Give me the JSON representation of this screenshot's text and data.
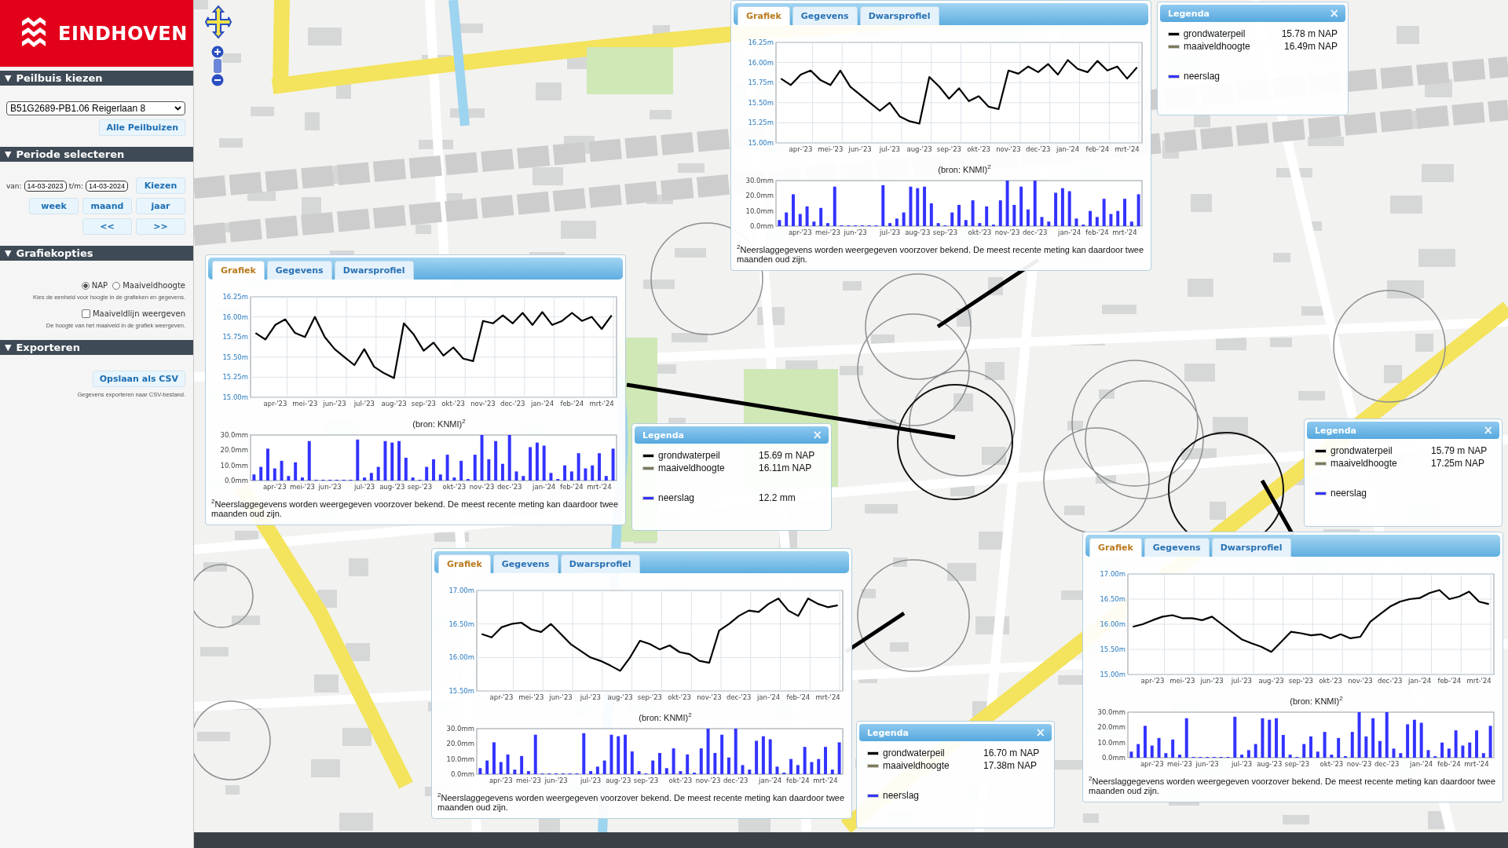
{
  "sidebar": {
    "logo": {
      "text": "EINDHOVEN"
    },
    "sections": [
      {
        "toggle": "▼",
        "title": "Peilbuis kiezen",
        "controls": [
          {
            "kind": "select",
            "value": "B51G2689-PB1.06 Reigerlaan 8"
          },
          {
            "kind": "button",
            "label": "Alle Peilbuizen"
          }
        ]
      },
      {
        "toggle": "▼",
        "title": "Periode selecteren",
        "controls": [
          {
            "kind": "date_range",
            "from_label": "van:",
            "from": "14-03-2023",
            "to_label": "t/m:",
            "to": "14-03-2024",
            "button": "Kiezen"
          },
          {
            "kind": "button_row",
            "buttons": [
              "week",
              "maand",
              "jaar"
            ]
          },
          {
            "kind": "button_row",
            "buttons": [
              "<<",
              ">>"
            ]
          }
        ]
      },
      {
        "toggle": "▼",
        "title": "Grafiekopties",
        "controls": [
          {
            "kind": "radio_group",
            "options": [
              {
                "label": "NAP",
                "selected": true
              },
              {
                "label": "Maaiveldhoogte",
                "selected": false
              }
            ]
          },
          {
            "kind": "hint",
            "text": "Kies de eenheid voor hoogte in de grafieken en gegevens."
          },
          {
            "kind": "checkbox",
            "label": "Maaiveldlijn weergeven",
            "checked": false
          },
          {
            "kind": "hint",
            "text": "De hoogte van het maaiveld in de grafiek weergeven."
          }
        ]
      },
      {
        "toggle": "▼",
        "title": "Exporteren",
        "controls": [
          {
            "kind": "button",
            "label": "Opslaan als CSV"
          },
          {
            "kind": "hint",
            "text": "Gegevens exporteren naar CSV-bestand."
          }
        ]
      }
    ]
  },
  "chart_panels": [
    {
      "tabs": [
        {
          "label": "Grafiek",
          "selected": true
        },
        {
          "label": "Gegevens",
          "selected": false
        },
        {
          "label": "Dwarsprofiel",
          "selected": false
        }
      ],
      "level_chart": {
        "chart_data": {
          "type": "line",
          "categories": [
            null,
            null,
            "apr-'23",
            null,
            null,
            "mei-'23",
            null,
            null,
            "jun-'23",
            null,
            null,
            "jul-'23",
            null,
            null,
            "aug-'23",
            null,
            null,
            "sep-'23",
            null,
            null,
            "okt-'23",
            null,
            null,
            "nov-'23",
            null,
            null,
            "dec-'23",
            null,
            null,
            "jan-'24",
            null,
            null,
            "feb-'24",
            null,
            null,
            "mrt-'24",
            null
          ],
          "series": [
            {
              "color": "#000000",
              "values": [
                15.8,
                15.72,
                15.85,
                15.9,
                15.78,
                15.72,
                15.9,
                15.7,
                15.6,
                15.5,
                15.4,
                15.5,
                15.33,
                15.27,
                15.24,
                15.82,
                15.7,
                15.55,
                15.68,
                15.52,
                15.58,
                15.45,
                15.42,
                15.9,
                15.86,
                15.95,
                15.88,
                15.98,
                15.85,
                16.03,
                15.92,
                15.88,
                16.02,
                15.9,
                15.95,
                15.8,
                15.94
              ]
            }
          ],
          "grid": true,
          "ylim": [
            15,
            16.25
          ],
          "yticks": [
            {
              "value": 15,
              "label": "15.00m"
            },
            {
              "value": 15.25,
              "label": "15.25m"
            },
            {
              "value": 15.5,
              "label": "15.50m"
            },
            {
              "value": 15.75,
              "label": "15.75m"
            },
            {
              "value": 16,
              "label": "16.00m"
            },
            {
              "value": 16.25,
              "label": "16.25m"
            }
          ]
        }
      },
      "source": "(bron: KNMI)$^{2}$",
      "rain_chart": {
        "chart_data": {
          "type": "bar",
          "categories": [
            null,
            null,
            null,
            "apr-'23",
            null,
            null,
            null,
            "mei-'23",
            null,
            null,
            null,
            "jun-'23",
            null,
            null,
            null,
            null,
            "jul-'23",
            null,
            null,
            null,
            "aug-'23",
            null,
            null,
            null,
            "sep-'23",
            null,
            null,
            null,
            null,
            "okt-'23",
            null,
            null,
            null,
            "nov-'23",
            null,
            null,
            null,
            "dec-'23",
            null,
            null,
            null,
            null,
            "jan-'24",
            null,
            null,
            null,
            "feb-'24",
            null,
            null,
            null,
            "mrt-'24",
            null,
            null
          ],
          "series": [
            {
              "color": "#3333ff",
              "values": [
                4,
                9,
                21,
                8,
                13,
                3,
                12,
                2,
                26,
                0,
                0,
                0,
                0,
                0,
                0,
                27,
                2,
                5,
                9,
                26,
                25,
                26,
                15,
                2,
                0,
                9,
                14,
                4,
                17,
                2,
                13,
                1,
                17,
                30,
                14,
                26,
                11,
                30,
                6,
                3,
                22,
                25,
                23,
                5,
                1,
                10,
                6,
                18,
                8,
                10,
                18,
                3,
                21
              ]
            }
          ],
          "ylim": [
            0,
            30
          ],
          "yticks": [
            {
              "value": 0,
              "label": "0.0mm"
            },
            {
              "value": 10,
              "label": "10.0mm"
            },
            {
              "value": 20,
              "label": "20.0mm"
            },
            {
              "value": 30,
              "label": "30.0mm"
            }
          ]
        }
      },
      "footnote": "$^{2}$Neerslaggegevens worden weergegeven voorzover bekend. De meest recente meting kan daardoor twee maanden oud zijn."
    },
    {
      "tabs": [
        {
          "label": "Grafiek",
          "selected": true
        },
        {
          "label": "Gegevens",
          "selected": false
        },
        {
          "label": "Dwarsprofiel",
          "selected": false
        }
      ],
      "level_chart": {
        "chart_data": {
          "type": "line",
          "categories": [
            null,
            null,
            "apr-'23",
            null,
            null,
            "mei-'23",
            null,
            null,
            "jun-'23",
            null,
            null,
            "jul-'23",
            null,
            null,
            "aug-'23",
            null,
            null,
            "sep-'23",
            null,
            null,
            "okt-'23",
            null,
            null,
            "nov-'23",
            null,
            null,
            "dec-'23",
            null,
            null,
            "jan-'24",
            null,
            null,
            "feb-'24",
            null,
            null,
            "mrt-'24",
            null
          ],
          "series": [
            {
              "color": "#000000",
              "values": [
                15.8,
                15.72,
                15.9,
                15.97,
                15.8,
                15.75,
                16.0,
                15.75,
                15.6,
                15.5,
                15.4,
                15.6,
                15.38,
                15.3,
                15.24,
                15.92,
                15.78,
                15.58,
                15.68,
                15.52,
                15.62,
                15.48,
                15.45,
                15.95,
                15.92,
                16.02,
                15.92,
                16.05,
                15.9,
                16.06,
                15.9,
                15.95,
                16.05,
                15.95,
                16.0,
                15.85,
                16.02
              ]
            }
          ],
          "grid": true,
          "ylim": [
            15,
            16.25
          ],
          "yticks": [
            {
              "value": 15,
              "label": "15.00m"
            },
            {
              "value": 15.25,
              "label": "15.25m"
            },
            {
              "value": 15.5,
              "label": "15.50m"
            },
            {
              "value": 15.75,
              "label": "15.75m"
            },
            {
              "value": 16,
              "label": "16.00m"
            },
            {
              "value": 16.25,
              "label": "16.25m"
            }
          ]
        }
      },
      "source": "(bron: KNMI)$^{2}$",
      "rain_chart": {
        "chart_data": {
          "type": "bar",
          "categories": [
            null,
            null,
            null,
            "apr-'23",
            null,
            null,
            null,
            "mei-'23",
            null,
            null,
            null,
            "jun-'23",
            null,
            null,
            null,
            null,
            "jul-'23",
            null,
            null,
            null,
            "aug-'23",
            null,
            null,
            null,
            "sep-'23",
            null,
            null,
            null,
            null,
            "okt-'23",
            null,
            null,
            null,
            "nov-'23",
            null,
            null,
            null,
            "dec-'23",
            null,
            null,
            null,
            null,
            "jan-'24",
            null,
            null,
            null,
            "feb-'24",
            null,
            null,
            null,
            "mrt-'24",
            null,
            null
          ],
          "series": [
            {
              "color": "#3333ff",
              "values": [
                4,
                9,
                21,
                8,
                13,
                3,
                12,
                2,
                26,
                0,
                0,
                0,
                0,
                0,
                0,
                27,
                2,
                5,
                9,
                26,
                25,
                26,
                15,
                2,
                0,
                9,
                14,
                4,
                17,
                2,
                13,
                1,
                17,
                30,
                14,
                26,
                11,
                30,
                6,
                3,
                22,
                25,
                23,
                5,
                1,
                10,
                6,
                18,
                8,
                10,
                18,
                3,
                21
              ]
            }
          ],
          "ylim": [
            0,
            30
          ],
          "yticks": [
            {
              "value": 0,
              "label": "0.0mm"
            },
            {
              "value": 10,
              "label": "10.0mm"
            },
            {
              "value": 20,
              "label": "20.0mm"
            },
            {
              "value": 30,
              "label": "30.0mm"
            }
          ]
        }
      },
      "footnote": "$^{2}$Neerslaggegevens worden weergegeven voorzover bekend. De meest recente meting kan daardoor twee maanden oud zijn."
    },
    {
      "tabs": [
        {
          "label": "Grafiek",
          "selected": true
        },
        {
          "label": "Gegevens",
          "selected": false
        },
        {
          "label": "Dwarsprofiel",
          "selected": false
        }
      ],
      "level_chart": {
        "chart_data": {
          "type": "line",
          "categories": [
            null,
            null,
            "apr-'23",
            null,
            null,
            "mei-'23",
            null,
            null,
            "jun-'23",
            null,
            null,
            "jul-'23",
            null,
            null,
            "aug-'23",
            null,
            null,
            "sep-'23",
            null,
            null,
            "okt-'23",
            null,
            null,
            "nov-'23",
            null,
            null,
            "dec-'23",
            null,
            null,
            "jan-'24",
            null,
            null,
            "feb-'24",
            null,
            null,
            "mrt-'24",
            null
          ],
          "series": [
            {
              "color": "#000000",
              "values": [
                16.35,
                16.3,
                16.45,
                16.5,
                16.52,
                16.42,
                16.38,
                16.5,
                16.35,
                16.2,
                16.1,
                16.0,
                15.95,
                15.88,
                15.8,
                16.0,
                16.25,
                16.2,
                16.12,
                16.18,
                16.08,
                16.05,
                15.95,
                15.92,
                16.4,
                16.5,
                16.62,
                16.7,
                16.68,
                16.8,
                16.88,
                16.7,
                16.62,
                16.88,
                16.8,
                16.75,
                16.78
              ]
            }
          ],
          "grid": true,
          "ylim": [
            15.5,
            17
          ],
          "yticks": [
            {
              "value": 15.5,
              "label": "15.50m"
            },
            {
              "value": 16,
              "label": "16.00m"
            },
            {
              "value": 16.5,
              "label": "16.50m"
            },
            {
              "value": 17,
              "label": "17.00m"
            }
          ]
        }
      },
      "source": "(bron: KNMI)$^{2}$",
      "rain_chart": {
        "chart_data": {
          "type": "bar",
          "categories": [
            null,
            null,
            null,
            "apr-'23",
            null,
            null,
            null,
            "mei-'23",
            null,
            null,
            null,
            "jun-'23",
            null,
            null,
            null,
            null,
            "jul-'23",
            null,
            null,
            null,
            "aug-'23",
            null,
            null,
            null,
            "sep-'23",
            null,
            null,
            null,
            null,
            "okt-'23",
            null,
            null,
            null,
            "nov-'23",
            null,
            null,
            null,
            "dec-'23",
            null,
            null,
            null,
            null,
            "jan-'24",
            null,
            null,
            null,
            "feb-'24",
            null,
            null,
            null,
            "mrt-'24",
            null,
            null
          ],
          "series": [
            {
              "color": "#3333ff",
              "values": [
                4,
                9,
                21,
                8,
                13,
                3,
                12,
                2,
                26,
                0,
                0,
                0,
                0,
                0,
                0,
                27,
                2,
                5,
                9,
                26,
                25,
                26,
                15,
                2,
                0,
                9,
                14,
                4,
                17,
                2,
                13,
                1,
                17,
                30,
                14,
                26,
                11,
                30,
                6,
                3,
                22,
                25,
                23,
                5,
                1,
                10,
                6,
                18,
                8,
                10,
                18,
                3,
                21
              ]
            }
          ],
          "ylim": [
            0,
            30
          ],
          "yticks": [
            {
              "value": 0,
              "label": "0.0mm"
            },
            {
              "value": 10,
              "label": "10.0mm"
            },
            {
              "value": 20,
              "label": "20.0mm"
            },
            {
              "value": 30,
              "label": "30.0mm"
            }
          ]
        }
      },
      "footnote": "$^{2}$Neerslaggegevens worden weergegeven voorzover bekend. De meest recente meting kan daardoor twee maanden oud zijn."
    },
    {
      "tabs": [
        {
          "label": "Grafiek",
          "selected": true
        },
        {
          "label": "Gegevens",
          "selected": false
        },
        {
          "label": "Dwarsprofiel",
          "selected": false
        }
      ],
      "level_chart": {
        "chart_data": {
          "type": "line",
          "categories": [
            null,
            null,
            "apr-'23",
            null,
            null,
            "mei-'23",
            null,
            null,
            "jun-'23",
            null,
            null,
            "jul-'23",
            null,
            null,
            "aug-'23",
            null,
            null,
            "sep-'23",
            null,
            null,
            "okt-'23",
            null,
            null,
            "nov-'23",
            null,
            null,
            "dec-'23",
            null,
            null,
            "jan-'24",
            null,
            null,
            "feb-'24",
            null,
            null,
            "mrt-'24",
            null
          ],
          "series": [
            {
              "color": "#000000",
              "values": [
                15.95,
                16.0,
                16.08,
                16.15,
                16.18,
                16.12,
                16.12,
                16.08,
                16.15,
                16.0,
                15.85,
                15.7,
                15.62,
                15.55,
                15.45,
                15.65,
                15.85,
                15.82,
                15.78,
                15.8,
                15.72,
                15.8,
                15.72,
                15.75,
                16.05,
                16.2,
                16.35,
                16.45,
                16.5,
                16.52,
                16.62,
                16.68,
                16.5,
                16.55,
                16.65,
                16.45,
                16.4
              ]
            }
          ],
          "grid": true,
          "ylim": [
            15,
            17
          ],
          "yticks": [
            {
              "value": 15,
              "label": "15.00m"
            },
            {
              "value": 15.5,
              "label": "15.50m"
            },
            {
              "value": 16,
              "label": "16.00m"
            },
            {
              "value": 16.5,
              "label": "16.50m"
            },
            {
              "value": 17,
              "label": "17.00m"
            }
          ]
        }
      },
      "source": "(bron: KNMI)$^{2}$",
      "rain_chart": {
        "chart_data": {
          "type": "bar",
          "categories": [
            null,
            null,
            null,
            "apr-'23",
            null,
            null,
            null,
            "mei-'23",
            null,
            null,
            null,
            "jun-'23",
            null,
            null,
            null,
            null,
            "jul-'23",
            null,
            null,
            null,
            "aug-'23",
            null,
            null,
            null,
            "sep-'23",
            null,
            null,
            null,
            null,
            "okt-'23",
            null,
            null,
            null,
            "nov-'23",
            null,
            null,
            null,
            "dec-'23",
            null,
            null,
            null,
            null,
            "jan-'24",
            null,
            null,
            null,
            "feb-'24",
            null,
            null,
            null,
            "mrt-'24",
            null,
            null
          ],
          "series": [
            {
              "color": "#3333ff",
              "values": [
                4,
                9,
                21,
                8,
                13,
                3,
                12,
                2,
                26,
                0,
                0,
                0,
                0,
                0,
                0,
                27,
                2,
                5,
                9,
                26,
                25,
                26,
                15,
                2,
                0,
                9,
                14,
                4,
                17,
                2,
                13,
                1,
                17,
                30,
                14,
                26,
                11,
                30,
                6,
                3,
                22,
                25,
                23,
                5,
                1,
                10,
                6,
                18,
                8,
                10,
                18,
                3,
                21
              ]
            }
          ],
          "ylim": [
            0,
            30
          ],
          "yticks": [
            {
              "value": 0,
              "label": "0.0mm"
            },
            {
              "value": 10,
              "label": "10.0mm"
            },
            {
              "value": 20,
              "label": "20.0mm"
            },
            {
              "value": 30,
              "label": "30.0mm"
            }
          ]
        }
      },
      "footnote": "$^{2}$Neerslaggegevens worden weergegeven voorzover bekend. De meest recente meting kan daardoor twee maanden oud zijn."
    }
  ],
  "legends": [
    {
      "title": "Legenda",
      "close": "×",
      "items": [
        {
          "label": "grondwaterpeil",
          "value": "15.78 m NAP",
          "color": "#000000"
        },
        {
          "label": "maaiveldhoogte",
          "value": "16.49m NAP",
          "color": "#7d7a5c"
        },
        {
          "label": "neerslag",
          "color": "#3333ff"
        }
      ]
    },
    {
      "title": "Legenda",
      "close": "×",
      "items": [
        {
          "label": "grondwaterpeil",
          "value": "15.69 m NAP",
          "color": "#000000"
        },
        {
          "label": "maaiveldhoogte",
          "value": "16.11m NAP",
          "color": "#7d7a5c"
        },
        {
          "label": "neerslag",
          "value": "12.2 mm",
          "color": "#3333ff"
        }
      ]
    },
    {
      "title": "Legenda",
      "close": "×",
      "items": [
        {
          "label": "grondwaterpeil",
          "value": "15.79 m NAP",
          "color": "#000000"
        },
        {
          "label": "maaiveldhoogte",
          "value": "17.25m NAP",
          "color": "#7d7a5c"
        },
        {
          "label": "neerslag",
          "color": "#3333ff"
        }
      ]
    },
    {
      "title": "Legenda",
      "close": "×",
      "items": [
        {
          "label": "grondwaterpeil",
          "value": "16.70 m NAP",
          "color": "#000000"
        },
        {
          "label": "maaiveldhoogte",
          "value": "17.38m NAP",
          "color": "#7d7a5c"
        },
        {
          "label": "neerslag",
          "color": "#3333ff"
        }
      ]
    }
  ]
}
